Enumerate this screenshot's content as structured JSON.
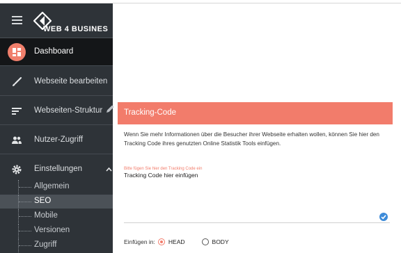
{
  "brand": {
    "logo_text": "WEB 4 BUSINES"
  },
  "sidebar": {
    "items": [
      {
        "label": "Dashboard",
        "icon": "dashboard-icon"
      },
      {
        "label": "Webseite bearbeiten",
        "icon": "brush-icon"
      },
      {
        "label": "Webseiten-Struktur",
        "icon": "structure-icon"
      },
      {
        "label": "Nutzer-Zugriff",
        "icon": "users-icon"
      },
      {
        "label": "Einstellungen",
        "icon": "gear-icon"
      }
    ],
    "sub_items": [
      {
        "label": "Allgemein"
      },
      {
        "label": "SEO"
      },
      {
        "label": "Mobile"
      },
      {
        "label": "Versionen"
      },
      {
        "label": "Zugriff"
      }
    ]
  },
  "panel": {
    "title": "Tracking-Code",
    "description": "Wenn Sie mehr Informationen über die Besucher ihrer Webseite erhalten wollen, können Sie hier den Tracking Code ihres genutzten Online Statistik Tools einfügen.",
    "field_label": "Bitte fügen Sie hier den Tracking Code ein",
    "field_value": "Tracking Code hier einfügen",
    "insert_label": "Einfügen in:",
    "options": [
      {
        "label": "HEAD",
        "checked": true
      },
      {
        "label": "BODY",
        "checked": false
      }
    ]
  },
  "colors": {
    "accent": "#f27c6b",
    "sidebar_bg": "#2e3338",
    "check_blue": "#3d8bd9"
  }
}
